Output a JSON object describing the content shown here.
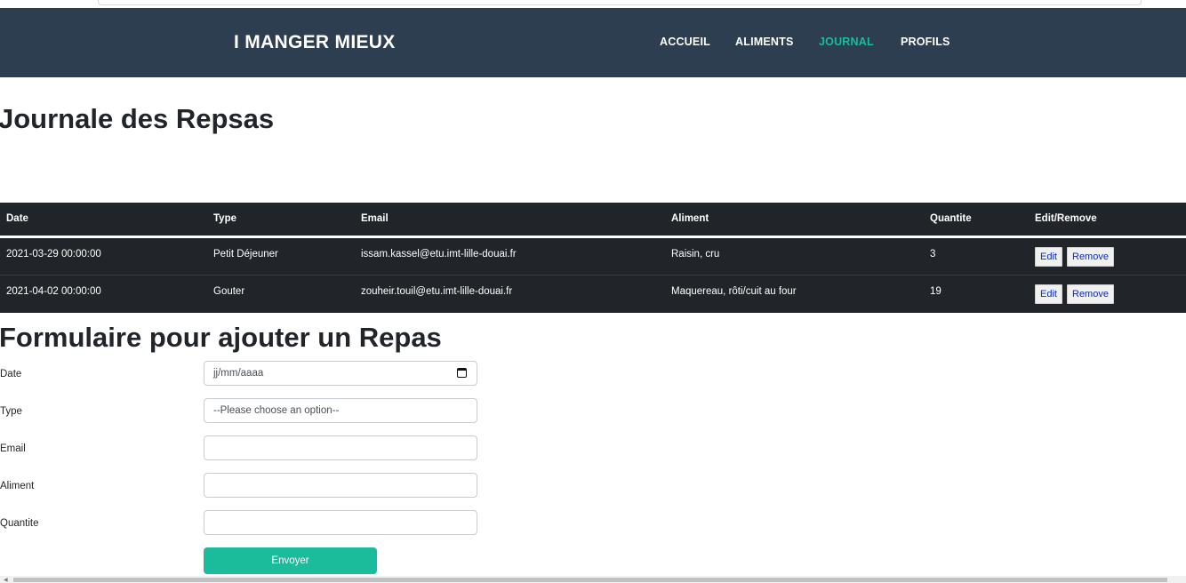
{
  "navbar": {
    "brand": "I MANGER MIEUX",
    "links": [
      "ACCUEIL",
      "ALIMENTS",
      "JOURNAL",
      "PROFILS"
    ],
    "active": "JOURNAL",
    "accent_color": "#1abc9c",
    "bg_color": "#2c3e50"
  },
  "page_title": "Journale des Repsas",
  "table": {
    "headers": [
      "Date",
      "Type",
      "Email",
      "Aliment",
      "Quantite",
      "Edit/Remove"
    ],
    "rows": [
      {
        "date": "2021-03-29 00:00:00",
        "type": "Petit Déjeuner",
        "email": "issam.kassel@etu.imt-lille-douai.fr",
        "aliment": "Raisin, cru",
        "quantite": "3"
      },
      {
        "date": "2021-04-02 00:00:00",
        "type": "Gouter",
        "email": "zouheir.touil@etu.imt-lille-douai.fr",
        "aliment": "Maquereau, rôti/cuit au four",
        "quantite": "19"
      }
    ],
    "edit_label": "Edit",
    "remove_label": "Remove"
  },
  "form": {
    "title": "Formulaire pour ajouter un Repas",
    "date_label": "Date",
    "date_placeholder": "jj/mm/aaaa",
    "type_label": "Type",
    "type_selected": "--Please choose an option--",
    "email_label": "Email",
    "email_value": "",
    "aliment_label": "Aliment",
    "aliment_value": "",
    "quantite_label": "Quantite",
    "quantite_value": "",
    "submit_label": "Envoyer"
  }
}
